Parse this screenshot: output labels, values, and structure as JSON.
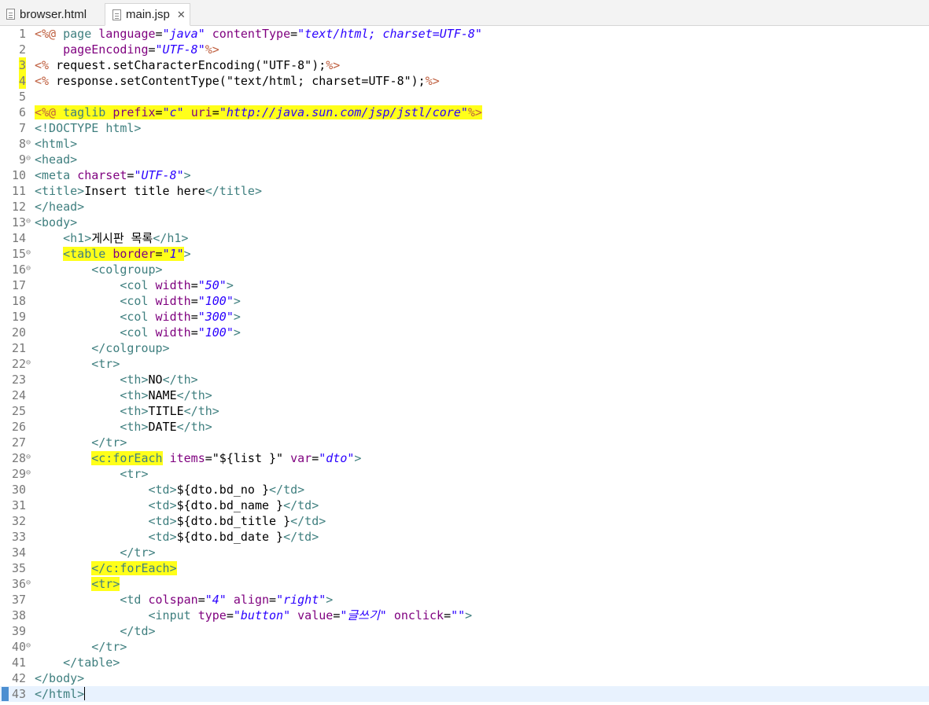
{
  "tabs": [
    {
      "label": "browser.html",
      "active": false
    },
    {
      "label": "main.jsp",
      "active": true
    }
  ],
  "lines": [
    {
      "n": "1",
      "spans": [
        [
          "d",
          "<%@"
        ],
        [
          "t",
          " "
        ],
        [
          "dir",
          "page"
        ],
        [
          "t",
          " "
        ],
        [
          "a",
          "language"
        ],
        [
          "t",
          "="
        ],
        [
          "v",
          "\"java\""
        ],
        [
          "t",
          " "
        ],
        [
          "a",
          "contentType"
        ],
        [
          "t",
          "="
        ],
        [
          "v",
          "\"text/html; charset=UTF-8\""
        ]
      ]
    },
    {
      "n": "2",
      "spans": [
        [
          "t",
          "    "
        ],
        [
          "a",
          "pageEncoding"
        ],
        [
          "t",
          "="
        ],
        [
          "v",
          "\"UTF-8\""
        ],
        [
          "d",
          "%>"
        ]
      ]
    },
    {
      "n": "3",
      "mark": true,
      "spans": [
        [
          "d",
          "<%"
        ],
        [
          "t",
          " request.setCharacterEncoding(\"UTF-8\");"
        ],
        [
          "d",
          "%>"
        ]
      ]
    },
    {
      "n": "4",
      "mark": true,
      "spans": [
        [
          "d",
          "<%"
        ],
        [
          "t",
          " response.setContentType(\"text/html; charset=UTF-8\");"
        ],
        [
          "d",
          "%>"
        ]
      ]
    },
    {
      "n": "5",
      "spans": []
    },
    {
      "n": "6",
      "hl": true,
      "spans": [
        [
          "d",
          "<%@"
        ],
        [
          "t",
          " "
        ],
        [
          "dir",
          "taglib"
        ],
        [
          "t",
          " "
        ],
        [
          "a",
          "prefix"
        ],
        [
          "t",
          "="
        ],
        [
          "v",
          "\"c\""
        ],
        [
          "t",
          " "
        ],
        [
          "a",
          "uri"
        ],
        [
          "t",
          "="
        ],
        [
          "v",
          "\"http://java.sun.com/jsp/jstl/core\""
        ],
        [
          "d",
          "%>"
        ]
      ]
    },
    {
      "n": "7",
      "spans": [
        [
          "tag",
          "<!DOCTYPE"
        ],
        [
          "t",
          " "
        ],
        [
          "tag",
          "html>"
        ]
      ]
    },
    {
      "n": "8",
      "fold": true,
      "spans": [
        [
          "tag",
          "<html>"
        ]
      ]
    },
    {
      "n": "9",
      "fold": true,
      "spans": [
        [
          "tag",
          "<head>"
        ]
      ]
    },
    {
      "n": "10",
      "spans": [
        [
          "tag",
          "<meta"
        ],
        [
          "t",
          " "
        ],
        [
          "a",
          "charset"
        ],
        [
          "t",
          "="
        ],
        [
          "v",
          "\"UTF-8\""
        ],
        [
          "tag",
          ">"
        ]
      ]
    },
    {
      "n": "11",
      "spans": [
        [
          "tag",
          "<title>"
        ],
        [
          "t",
          "Insert title here"
        ],
        [
          "tag",
          "</title>"
        ]
      ]
    },
    {
      "n": "12",
      "spans": [
        [
          "tag",
          "</head>"
        ]
      ]
    },
    {
      "n": "13",
      "fold": true,
      "spans": [
        [
          "tag",
          "<body>"
        ]
      ]
    },
    {
      "n": "14",
      "spans": [
        [
          "t",
          "    "
        ],
        [
          "tag",
          "<h1>"
        ],
        [
          "t",
          "게시판 목록"
        ],
        [
          "tag",
          "</h1>"
        ]
      ]
    },
    {
      "n": "15",
      "fold": true,
      "spans": [
        [
          "t",
          "    "
        ],
        [
          "tag",
          "<table",
          "h"
        ],
        [
          "t",
          " ",
          "h"
        ],
        [
          "a",
          "border",
          "h"
        ],
        [
          "t",
          "=",
          "h"
        ],
        [
          "v",
          "\"1\"",
          "h"
        ],
        [
          "tag",
          ">"
        ]
      ]
    },
    {
      "n": "16",
      "fold": true,
      "spans": [
        [
          "t",
          "        "
        ],
        [
          "tag",
          "<colgroup>"
        ]
      ]
    },
    {
      "n": "17",
      "spans": [
        [
          "t",
          "            "
        ],
        [
          "tag",
          "<col"
        ],
        [
          "t",
          " "
        ],
        [
          "a",
          "width"
        ],
        [
          "t",
          "="
        ],
        [
          "v",
          "\"50\""
        ],
        [
          "tag",
          ">"
        ]
      ]
    },
    {
      "n": "18",
      "spans": [
        [
          "t",
          "            "
        ],
        [
          "tag",
          "<col"
        ],
        [
          "t",
          " "
        ],
        [
          "a",
          "width"
        ],
        [
          "t",
          "="
        ],
        [
          "v",
          "\"100\""
        ],
        [
          "tag",
          ">"
        ]
      ]
    },
    {
      "n": "19",
      "spans": [
        [
          "t",
          "            "
        ],
        [
          "tag",
          "<col"
        ],
        [
          "t",
          " "
        ],
        [
          "a",
          "width"
        ],
        [
          "t",
          "="
        ],
        [
          "v",
          "\"300\""
        ],
        [
          "tag",
          ">"
        ]
      ]
    },
    {
      "n": "20",
      "spans": [
        [
          "t",
          "            "
        ],
        [
          "tag",
          "<col"
        ],
        [
          "t",
          " "
        ],
        [
          "a",
          "width"
        ],
        [
          "t",
          "="
        ],
        [
          "v",
          "\"100\""
        ],
        [
          "tag",
          ">"
        ]
      ]
    },
    {
      "n": "21",
      "spans": [
        [
          "t",
          "        "
        ],
        [
          "tag",
          "</colgroup>"
        ]
      ]
    },
    {
      "n": "22",
      "fold": true,
      "spans": [
        [
          "t",
          "        "
        ],
        [
          "tag",
          "<tr>"
        ]
      ]
    },
    {
      "n": "23",
      "spans": [
        [
          "t",
          "            "
        ],
        [
          "tag",
          "<th>"
        ],
        [
          "t",
          "NO"
        ],
        [
          "tag",
          "</th>"
        ]
      ]
    },
    {
      "n": "24",
      "spans": [
        [
          "t",
          "            "
        ],
        [
          "tag",
          "<th>"
        ],
        [
          "t",
          "NAME"
        ],
        [
          "tag",
          "</th>"
        ]
      ]
    },
    {
      "n": "25",
      "spans": [
        [
          "t",
          "            "
        ],
        [
          "tag",
          "<th>"
        ],
        [
          "t",
          "TITLE"
        ],
        [
          "tag",
          "</th>"
        ]
      ]
    },
    {
      "n": "26",
      "spans": [
        [
          "t",
          "            "
        ],
        [
          "tag",
          "<th>"
        ],
        [
          "t",
          "DATE"
        ],
        [
          "tag",
          "</th>"
        ]
      ]
    },
    {
      "n": "27",
      "spans": [
        [
          "t",
          "        "
        ],
        [
          "tag",
          "</tr>"
        ]
      ]
    },
    {
      "n": "28",
      "fold": true,
      "spans": [
        [
          "t",
          "        "
        ],
        [
          "tag",
          "<c:forEach",
          "h"
        ],
        [
          "t",
          " "
        ],
        [
          "a",
          "items"
        ],
        [
          "t",
          "=\"${list }\" "
        ],
        [
          "a",
          "var"
        ],
        [
          "t",
          "="
        ],
        [
          "v",
          "\"dto\""
        ],
        [
          "tag",
          ">"
        ]
      ]
    },
    {
      "n": "29",
      "fold": true,
      "spans": [
        [
          "t",
          "            "
        ],
        [
          "tag",
          "<tr>"
        ]
      ]
    },
    {
      "n": "30",
      "spans": [
        [
          "t",
          "                "
        ],
        [
          "tag",
          "<td>"
        ],
        [
          "t",
          "${dto.bd_no }"
        ],
        [
          "tag",
          "</td>"
        ]
      ]
    },
    {
      "n": "31",
      "spans": [
        [
          "t",
          "                "
        ],
        [
          "tag",
          "<td>"
        ],
        [
          "t",
          "${dto.bd_name }"
        ],
        [
          "tag",
          "</td>"
        ]
      ]
    },
    {
      "n": "32",
      "spans": [
        [
          "t",
          "                "
        ],
        [
          "tag",
          "<td>"
        ],
        [
          "t",
          "${dto.bd_title }"
        ],
        [
          "tag",
          "</td>"
        ]
      ]
    },
    {
      "n": "33",
      "spans": [
        [
          "t",
          "                "
        ],
        [
          "tag",
          "<td>"
        ],
        [
          "t",
          "${dto.bd_date }"
        ],
        [
          "tag",
          "</td>"
        ]
      ]
    },
    {
      "n": "34",
      "spans": [
        [
          "t",
          "            "
        ],
        [
          "tag",
          "</tr>"
        ]
      ]
    },
    {
      "n": "35",
      "spans": [
        [
          "t",
          "        "
        ],
        [
          "tag",
          "</c:forEach>",
          "h"
        ]
      ]
    },
    {
      "n": "36",
      "fold": true,
      "spans": [
        [
          "t",
          "        "
        ],
        [
          "tag",
          "<tr>",
          "h"
        ]
      ]
    },
    {
      "n": "37",
      "spans": [
        [
          "t",
          "            "
        ],
        [
          "tag",
          "<td"
        ],
        [
          "t",
          " "
        ],
        [
          "a",
          "colspan"
        ],
        [
          "t",
          "="
        ],
        [
          "v",
          "\"4\""
        ],
        [
          "t",
          " "
        ],
        [
          "a",
          "align"
        ],
        [
          "t",
          "="
        ],
        [
          "v",
          "\"right\""
        ],
        [
          "tag",
          ">"
        ]
      ]
    },
    {
      "n": "38",
      "spans": [
        [
          "t",
          "                "
        ],
        [
          "tag",
          "<input"
        ],
        [
          "t",
          " "
        ],
        [
          "a",
          "type"
        ],
        [
          "t",
          "="
        ],
        [
          "v",
          "\"button\""
        ],
        [
          "t",
          " "
        ],
        [
          "a",
          "value"
        ],
        [
          "t",
          "="
        ],
        [
          "v",
          "\"글쓰기\""
        ],
        [
          "t",
          " "
        ],
        [
          "a",
          "onclick"
        ],
        [
          "t",
          "="
        ],
        [
          "v",
          "\"\""
        ],
        [
          "tag",
          ">"
        ]
      ]
    },
    {
      "n": "39",
      "spans": [
        [
          "t",
          "            "
        ],
        [
          "tag",
          "</td>"
        ]
      ]
    },
    {
      "n": "40",
      "fold": true,
      "spans": [
        [
          "t",
          "        "
        ],
        [
          "tag",
          "</tr>"
        ]
      ]
    },
    {
      "n": "41",
      "spans": [
        [
          "t",
          "    "
        ],
        [
          "tag",
          "</table>"
        ]
      ]
    },
    {
      "n": "42",
      "spans": [
        [
          "tag",
          "</body>"
        ]
      ]
    },
    {
      "n": "43",
      "current": true,
      "bookmark": true,
      "spans": [
        [
          "tag",
          "</html>"
        ]
      ]
    }
  ]
}
